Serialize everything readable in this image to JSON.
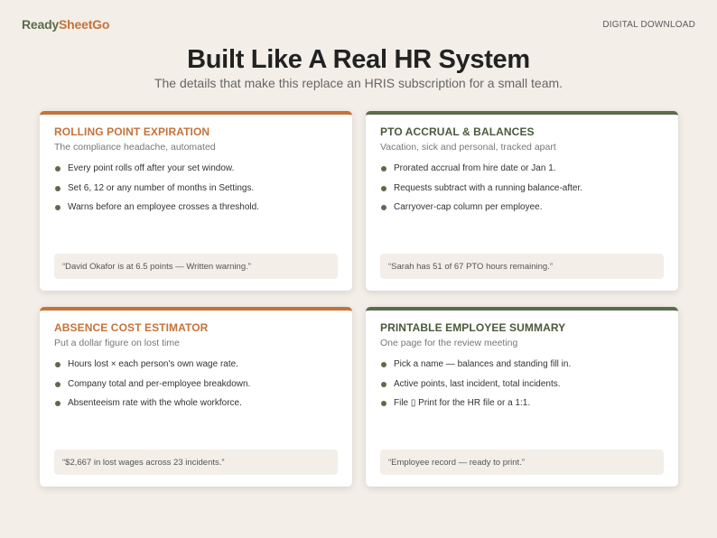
{
  "brand": {
    "part1": "Ready",
    "part2": "SheetGo"
  },
  "tag": "DIGITAL DOWNLOAD",
  "headline": "Built Like A Real HR System",
  "subhead": "The details that make this replace an HRIS subscription for a small team.",
  "cards": [
    {
      "title": "ROLLING POINT EXPIRATION",
      "subtitle": "The compliance headache, automated",
      "bullets": [
        "Every point rolls off after your set window.",
        "Set 6, 12 or any number of months in Settings.",
        "Warns before an employee crosses a threshold."
      ],
      "quote": "“David Okafor is at 6.5 points — Written warning.”"
    },
    {
      "title": "PTO ACCRUAL & BALANCES",
      "subtitle": "Vacation, sick and personal, tracked apart",
      "bullets": [
        "Prorated accrual from hire date or Jan 1.",
        "Requests subtract with a running balance-after.",
        "Carryover-cap column per employee."
      ],
      "quote": "“Sarah has 51 of 67 PTO hours remaining.”"
    },
    {
      "title": "ABSENCE COST ESTIMATOR",
      "subtitle": "Put a dollar figure on lost time",
      "bullets": [
        "Hours lost × each person's own wage rate.",
        "Company total and per-employee breakdown.",
        "Absenteeism rate with the whole workforce."
      ],
      "quote": "“$2,667 in lost wages across 23 incidents.”"
    },
    {
      "title": "PRINTABLE EMPLOYEE SUMMARY",
      "subtitle": "One page for the review meeting",
      "bullets": [
        "Pick a name — balances and standing fill in.",
        "Active points, last incident, total incidents.",
        "File ▯ Print for the HR file or a 1:1."
      ],
      "quote": "“Employee record — ready to print.”"
    }
  ],
  "colors": {
    "accent_orange": "#c4733a",
    "accent_green": "#5d6b4b",
    "background": "#f3eee8"
  }
}
